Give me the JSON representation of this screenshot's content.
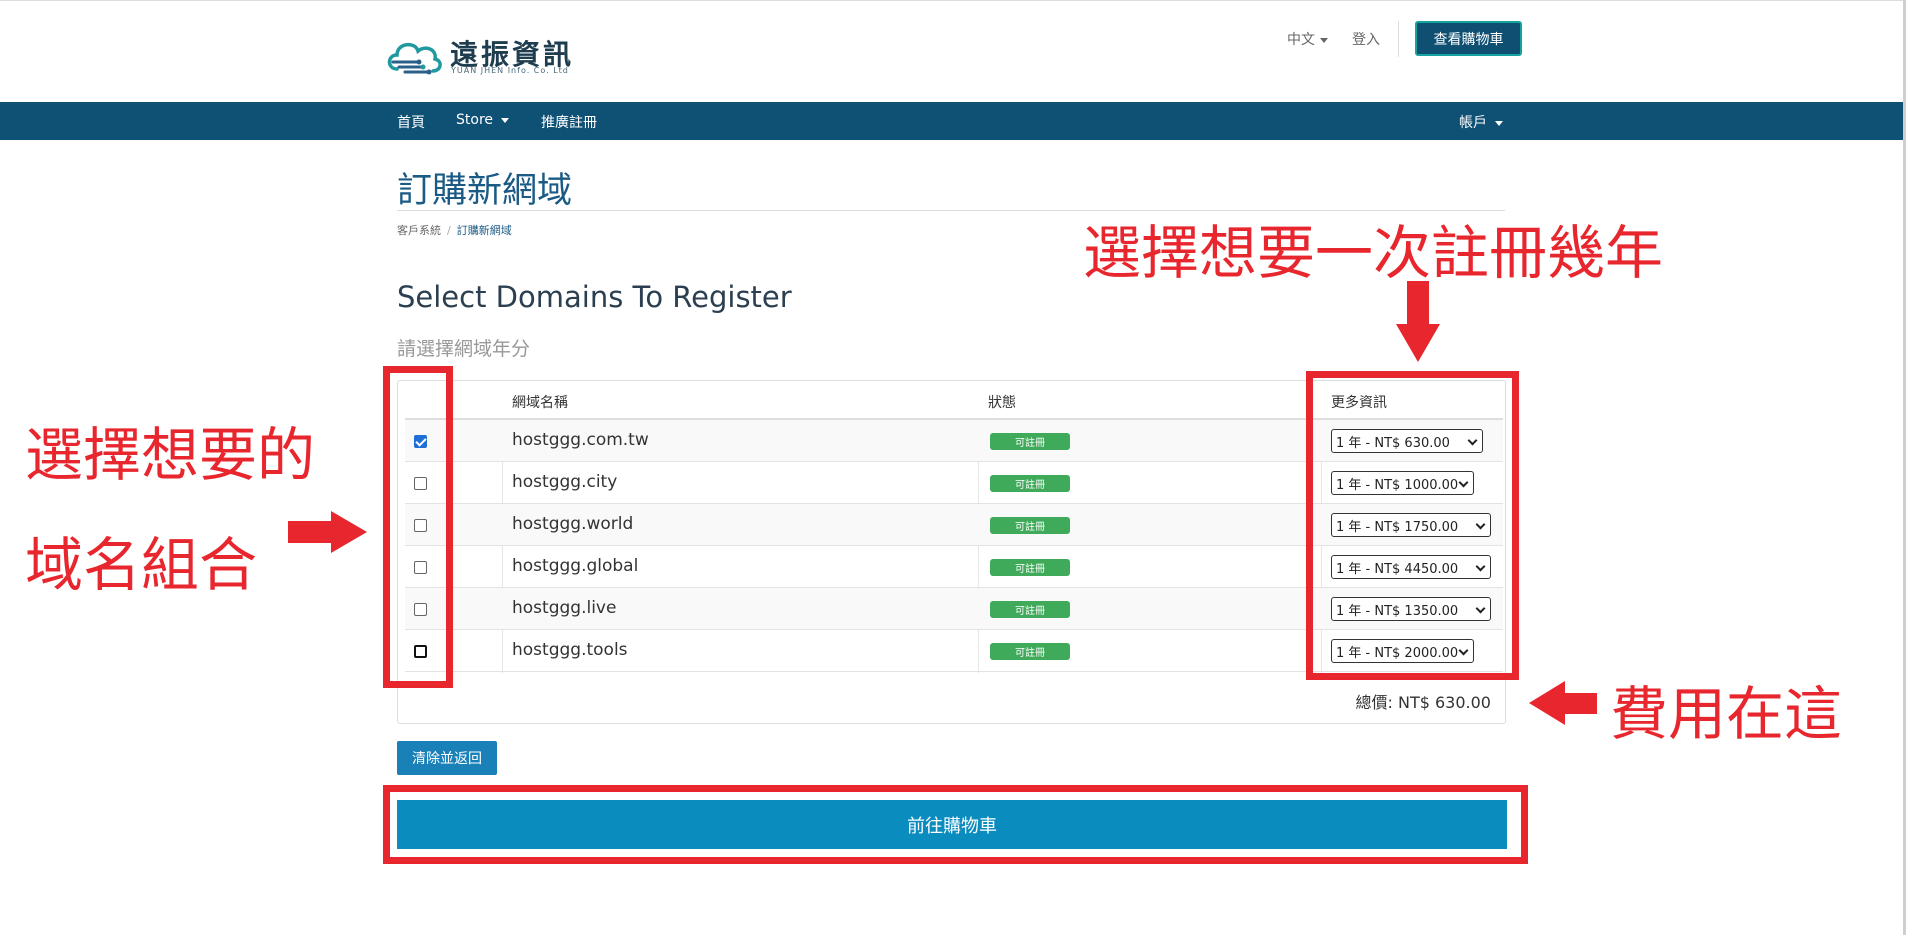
{
  "header": {
    "logo_main": "遠振資訊",
    "logo_sub": "YUAN JHEN Info. Co. Ltd",
    "language": "中文",
    "login": "登入",
    "view_cart": "查看購物車"
  },
  "nav": {
    "items": [
      {
        "label": "首頁",
        "has_caret": false
      },
      {
        "label": "Store",
        "has_caret": true
      },
      {
        "label": "推廣註冊",
        "has_caret": false
      }
    ],
    "account": "帳戶"
  },
  "page": {
    "title": "訂購新網域",
    "breadcrumb": [
      "客戶系統",
      "訂購新網域"
    ],
    "section_title": "Select Domains To Register",
    "section_subtitle": "請選擇網域年分"
  },
  "table": {
    "columns": [
      "網域名稱",
      "狀態",
      "更多資訊"
    ],
    "rows": [
      {
        "checked": true,
        "domain": "hostggg.com.tw",
        "status": "可註冊",
        "option": "1 年 - NT$ 630.00"
      },
      {
        "checked": false,
        "domain": "hostggg.city",
        "status": "可註冊",
        "option": "1 年 - NT$ 1000.00"
      },
      {
        "checked": false,
        "domain": "hostggg.world",
        "status": "可註冊",
        "option": "1 年 - NT$ 1750.00"
      },
      {
        "checked": false,
        "domain": "hostggg.global",
        "status": "可註冊",
        "option": "1 年 - NT$ 4450.00"
      },
      {
        "checked": false,
        "domain": "hostggg.live",
        "status": "可註冊",
        "option": "1 年 - NT$ 1350.00"
      },
      {
        "checked": false,
        "domain": "hostggg.tools",
        "status": "可註冊",
        "option": "1 年 - NT$ 2000.00"
      }
    ],
    "total": "總價: NT$ 630.00"
  },
  "actions": {
    "clear_back": "清除並返回",
    "checkout": "前往購物車"
  },
  "annotations": {
    "left_line1": "選擇想要的",
    "left_line2": "域名組合",
    "top_right": "選擇想要一次註冊幾年",
    "fee": "費用在這"
  },
  "colors": {
    "nav_bg": "#0f5075",
    "accent": "#0a8cbf",
    "badge": "#3fab5a",
    "annotation_red": "#e8262d"
  }
}
